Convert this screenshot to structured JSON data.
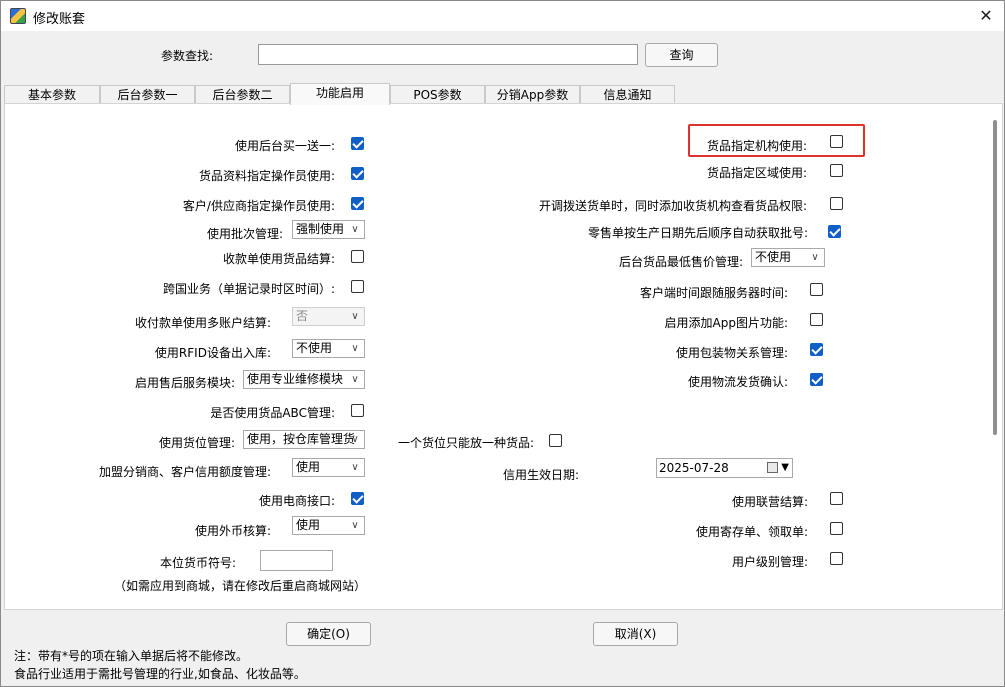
{
  "window": {
    "title": "修改账套",
    "close": "✕"
  },
  "search": {
    "label": "参数查找:",
    "value": "",
    "button": "查询"
  },
  "tabs": [
    "基本参数",
    "后台参数一",
    "后台参数二",
    "功能启用",
    "POS参数",
    "分销App参数",
    "信息通知"
  ],
  "active_tab": "功能启用",
  "left": {
    "r1": {
      "label": "使用后台买一送一:",
      "checked": true
    },
    "r2": {
      "label": "货品资料指定操作员使用:",
      "checked": true
    },
    "r3": {
      "label": "客户/供应商指定操作员使用:",
      "checked": true
    },
    "r4": {
      "label": "使用批次管理:",
      "select": "强制使用"
    },
    "r5": {
      "label": "收款单使用货品结算:",
      "checked": false
    },
    "r6": {
      "label": "跨国业务（单据记录时区时间）:",
      "checked": false
    },
    "r7": {
      "label": "收付款单使用多账户结算:",
      "select": "否",
      "disabled": true
    },
    "r8": {
      "label": "使用RFID设备出入库:",
      "select": "不使用"
    },
    "r9": {
      "label": "启用售后服务模块:",
      "select": "使用专业维修模块"
    },
    "r10": {
      "label": "是否使用货品ABC管理:",
      "checked": false
    },
    "r11": {
      "label": "使用货位管理:",
      "select": "使用，按仓库管理货"
    },
    "r12": {
      "label": "加盟分销商、客户信用额度管理:",
      "select": "使用"
    },
    "r13": {
      "label": "使用电商接口:",
      "checked": true
    },
    "r14": {
      "label": "使用外币核算:",
      "select": "使用"
    },
    "r15": {
      "label": "本位货币符号:",
      "value": ""
    },
    "r16": {
      "label": "（如需应用到商城，请在修改后重启商城网站）"
    }
  },
  "middle": {
    "one_item": {
      "label": "一个货位只能放一种货品:",
      "checked": false
    }
  },
  "right": {
    "r1": {
      "label": "货品指定机构使用:",
      "checked": false
    },
    "r2": {
      "label": "货品指定区域使用:",
      "checked": false
    },
    "r3": {
      "label": "开调拨送货单时，同时添加收货机构查看货品权限:",
      "checked": false
    },
    "r4": {
      "label": "零售单按生产日期先后顺序自动获取批号:",
      "checked": true
    },
    "r5": {
      "label": "后台货品最低售价管理:",
      "select": "不使用"
    },
    "r6": {
      "label": "客户端时间跟随服务器时间:",
      "checked": false
    },
    "r7": {
      "label": "启用添加App图片功能:",
      "checked": false
    },
    "r8": {
      "label": "使用包装物关系管理:",
      "checked": true
    },
    "r9": {
      "label": "使用物流发货确认:",
      "checked": true
    },
    "r10": {
      "label": "信用生效日期:",
      "date": "2025-07-28"
    },
    "r11": {
      "label": "使用联营结算:",
      "checked": false
    },
    "r12": {
      "label": "使用寄存单、领取单:",
      "checked": false
    },
    "r13": {
      "label": "用户级别管理:",
      "checked": false
    }
  },
  "buttons": {
    "ok": "确定(O)",
    "cancel": "取消(X)"
  },
  "notes": {
    "n1": "注：带有*号的项在输入单据后将不能修改。",
    "n2": "食品行业适用于需批号管理的行业,如食品、化妆品等。"
  },
  "colors": {
    "highlight": "#e0322d",
    "checkbox_checked": "#0f5fc6"
  }
}
